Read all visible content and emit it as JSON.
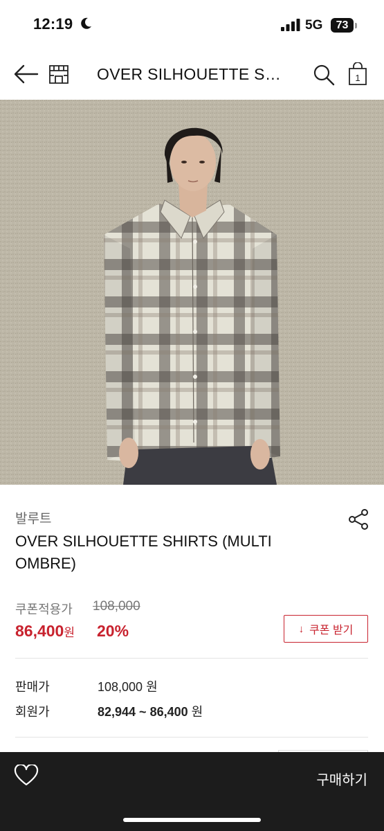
{
  "status": {
    "time": "12:19",
    "network": "5G",
    "battery": "73"
  },
  "nav": {
    "title": "OVER SILHOUETTE SHIRTS (MULTI OMBRE)",
    "bag_count": "1"
  },
  "product": {
    "brand": "발루트",
    "name": "OVER SILHOUETTE SHIRTS (MULTI OMBRE)"
  },
  "pricing": {
    "coupon_label": "쿠폰적용가",
    "original_price": "108,000",
    "sale_price": "86,400",
    "sale_unit": "원",
    "discount": "20%",
    "coupon_button": "쿠폰 받기",
    "coupon_icon": "↓"
  },
  "details": [
    {
      "label": "판매가",
      "value": "108,000",
      "unit": "원"
    },
    {
      "label": "회원가",
      "value": "82,944 ~ 86,400",
      "unit": "원"
    }
  ],
  "bottom_bar": {
    "buy_label": "구매하기"
  },
  "colors": {
    "accent": "#c8222e",
    "bottom_bar": "#1c1c1c"
  }
}
